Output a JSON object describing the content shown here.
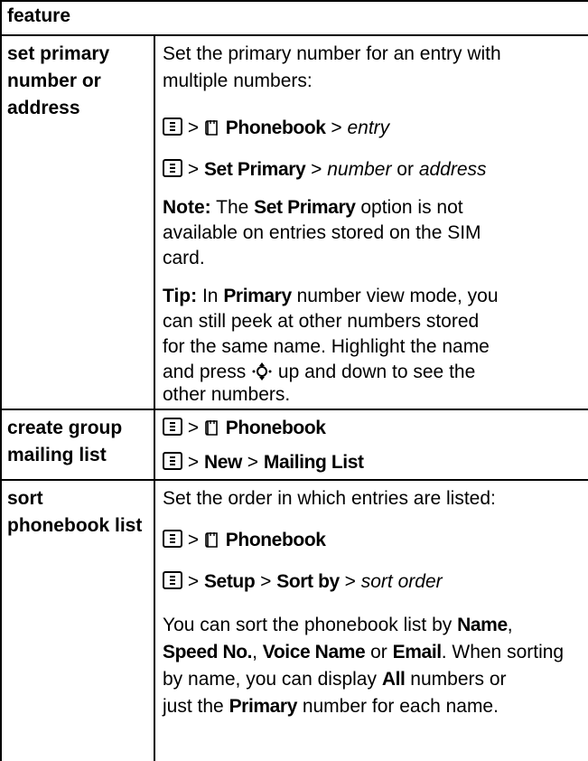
{
  "header": {
    "label": "feature"
  },
  "rows": [
    {
      "feature": [
        "set primary",
        "number or",
        "address"
      ],
      "intro": [
        "Set the primary number for an entry with",
        "multiple numbers:"
      ],
      "path1": {
        "menu": "Phonebook",
        "sep": ">",
        "target": "entry"
      },
      "path2": {
        "menu": "Set Primary",
        "sep": ">",
        "opt1": "number",
        "or": "or",
        "opt2": "address"
      },
      "note": {
        "label": "Note:",
        "line1_a": "The",
        "line1_menu": "Set Primary",
        "line1_b": "option is not",
        "line2": "available on entries stored on the SIM",
        "line3": "card."
      },
      "tip": {
        "label": "Tip:",
        "line1_a": "In",
        "line1_menu": "Primary",
        "line1_b": "number view mode, you",
        "line2": "can still peek at other numbers stored",
        "line3": "for the same name. Highlight the name",
        "line4_a": "and press",
        "line4_b": "up and down to see the",
        "line5": "other numbers."
      }
    },
    {
      "feature": [
        "create group",
        "mailing list"
      ],
      "path1": {
        "menu": "Phonebook",
        "sep": ">"
      },
      "path2": {
        "menu1": "New",
        "menu2": "Mailing List",
        "sep": ">"
      }
    },
    {
      "feature": [
        "sort",
        "phonebook list"
      ],
      "intro": "Set the order in which entries are listed:",
      "path1": {
        "menu": "Phonebook",
        "sep": ">"
      },
      "path2": {
        "menu1": "Setup",
        "menu2": "Sort by",
        "target": "sort order",
        "sep": ">"
      },
      "body": {
        "l1_a": "You can sort the phonebook list by",
        "l1_menu": "Name",
        "l2_m1": "Speed No.",
        "l2_m2": "Voice Name",
        "l2_or": "or",
        "l2_m3": "Email",
        "l2_b": "When sorting",
        "l3_a": "by name, you can display",
        "l3_menu": "All",
        "l3_b": "numbers or",
        "l4_a": "just the",
        "l4_menu": "Primary",
        "l4_b": "number for each name."
      }
    }
  ],
  "icons": {
    "menu_key": "menu-key-icon",
    "phonebook": "phonebook-icon",
    "nav_key": "nav-key-icon"
  }
}
